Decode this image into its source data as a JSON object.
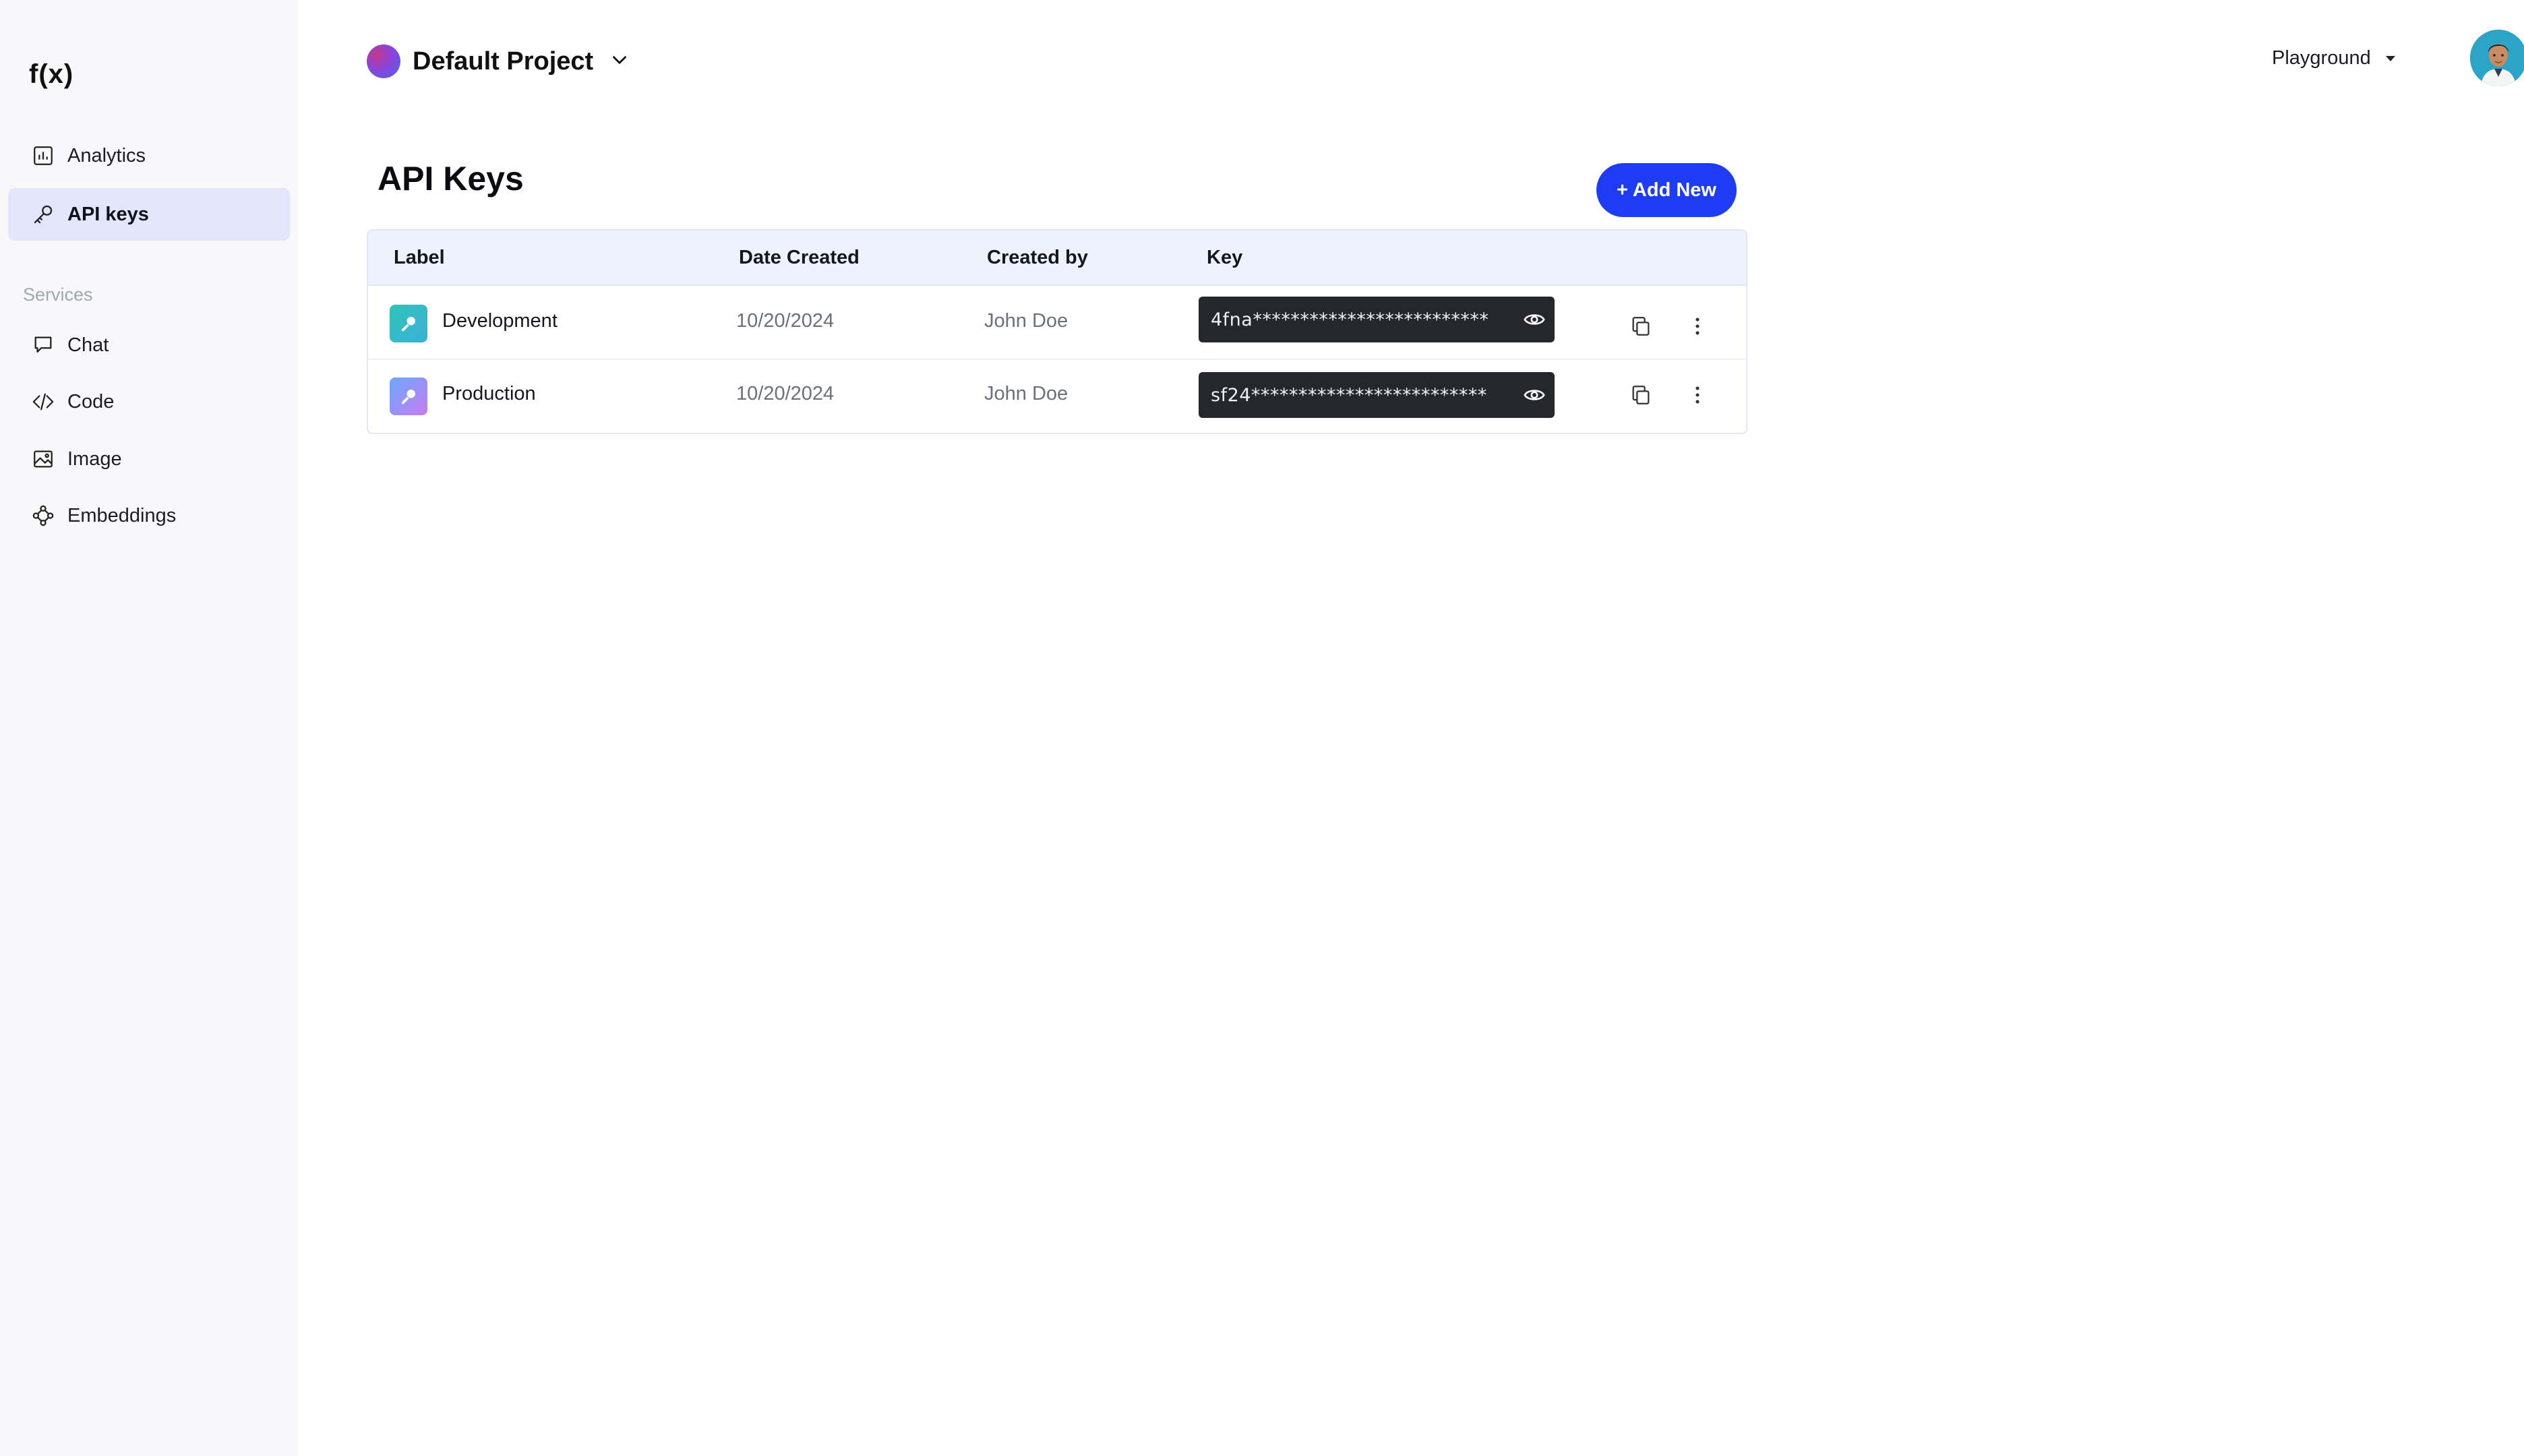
{
  "sidebar": {
    "logo": "f(x)",
    "items": [
      {
        "label": "Analytics",
        "icon": "bar-chart-icon"
      },
      {
        "label": "API keys",
        "icon": "key-icon",
        "active": true
      }
    ],
    "section_label": "Services",
    "services": [
      {
        "label": "Chat",
        "icon": "chat-bubble-icon"
      },
      {
        "label": "Code",
        "icon": "code-icon"
      },
      {
        "label": "Image",
        "icon": "image-icon"
      },
      {
        "label": "Embeddings",
        "icon": "embeddings-icon"
      }
    ]
  },
  "header": {
    "project_name": "Default Project",
    "playground_label": "Playground"
  },
  "main": {
    "title": "API Keys",
    "add_button": "+ Add New",
    "columns": [
      "Label",
      "Date Created",
      "Created by",
      "Key"
    ],
    "rows": [
      {
        "label": "Development",
        "date": "10/20/2024",
        "created_by": "John Doe",
        "key": "4fna*************************",
        "icon_color": "#2ec4b6"
      },
      {
        "label": "Production",
        "date": "10/20/2024",
        "created_by": "John Doe",
        "key": "sf24*************************",
        "icon_color": "#b07cf2"
      }
    ]
  },
  "colors": {
    "accent": "#1f3cf5",
    "sidebar_bg": "#f8f8fb",
    "active_nav_bg": "#e3e6fb",
    "table_header_bg": "#eef2fd",
    "key_box_bg": "#25272d"
  }
}
